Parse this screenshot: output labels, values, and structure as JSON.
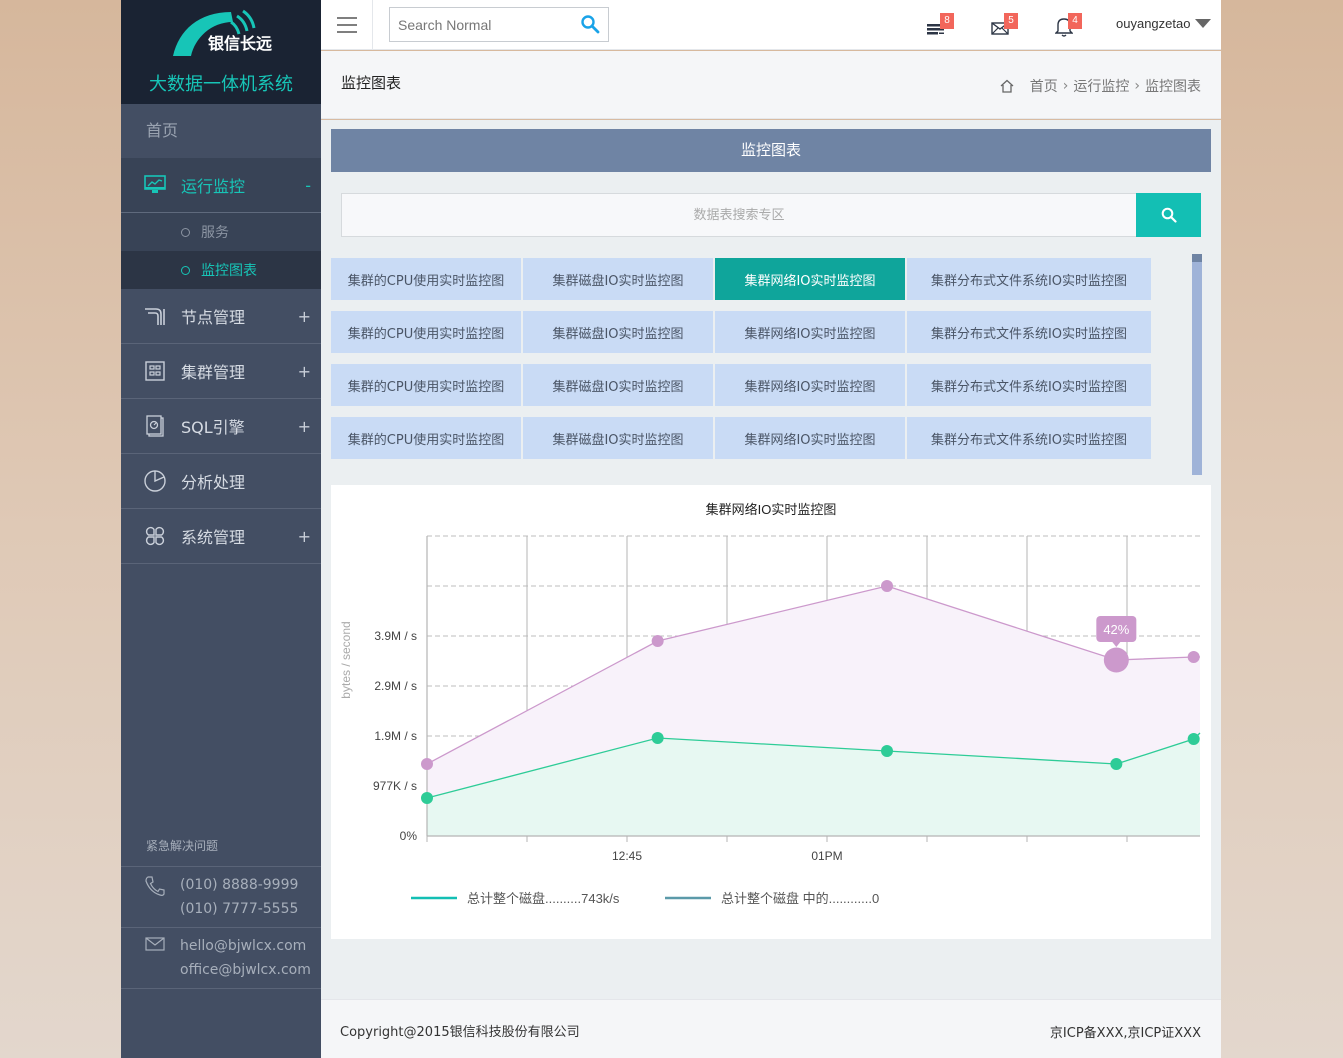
{
  "brand": {
    "logo_text": "银信长远",
    "system_name": "大数据一体机系统"
  },
  "sidebar": {
    "home_label": "首页",
    "items": [
      {
        "label": "运行监控",
        "icon": "monitor-chart-icon",
        "toggle": "-",
        "active": true,
        "children": [
          {
            "label": "服务",
            "active": false
          },
          {
            "label": "监控图表",
            "active": true
          }
        ]
      },
      {
        "label": "节点管理",
        "icon": "node-icon",
        "toggle": "+"
      },
      {
        "label": "集群管理",
        "icon": "cluster-grid-icon",
        "toggle": "+"
      },
      {
        "label": "SQL引擎",
        "icon": "sql-engine-icon",
        "toggle": "+"
      },
      {
        "label": "分析处理",
        "icon": "pie-chart-icon",
        "toggle": ""
      },
      {
        "label": "系统管理",
        "icon": "system-apps-icon",
        "toggle": "+"
      }
    ],
    "support": {
      "title": "紧急解决问题",
      "phones": [
        "(010) 8888-9999",
        "(010) 7777-5555"
      ],
      "emails": [
        "hello@bjwlcx.com",
        "office@bjwlcx.com"
      ]
    }
  },
  "topbar": {
    "search_placeholder": "Search Normal",
    "tasks_badge": "8",
    "messages_badge": "5",
    "notifications_badge": "4",
    "username": "ouyangzetao",
    "accent": "#1aa3e8"
  },
  "pagehead": {
    "title": "监控图表",
    "breadcrumb": [
      "首页",
      "运行监控",
      "监控图表"
    ]
  },
  "content": {
    "panel_title": "监控图表",
    "search_placeholder": "数据表搜索专区",
    "grid": [
      [
        "集群的CPU使用实时监控图",
        "集群磁盘IO实时监控图",
        "集群网络IO实时监控图",
        "集群分布式文件系统IO实时监控图"
      ],
      [
        "集群的CPU使用实时监控图",
        "集群磁盘IO实时监控图",
        "集群网络IO实时监控图",
        "集群分布式文件系统IO实时监控图"
      ],
      [
        "集群的CPU使用实时监控图",
        "集群磁盘IO实时监控图",
        "集群网络IO实时监控图",
        "集群分布式文件系统IO实时监控图"
      ],
      [
        "集群的CPU使用实时监控图",
        "集群磁盘IO实时监控图",
        "集群网络IO实时监控图",
        "集群分布式文件系统IO实时监控图"
      ]
    ],
    "selected_cell": [
      0,
      2
    ],
    "selected_color": "#0fa59b"
  },
  "chart_data": {
    "type": "area",
    "title": "集群网络IO实时监控图",
    "xlabel": "",
    "ylabel": "bytes / second",
    "x_unit": "minutes after 12:00",
    "xlim": [
      30,
      88
    ],
    "x_ticks": [
      {
        "value": 45,
        "label": "12:45"
      },
      {
        "value": 60,
        "label": "01PM"
      }
    ],
    "x_grid": [
      30,
      37.5,
      45,
      52.5,
      60,
      67.5,
      75,
      82.5
    ],
    "ylim": [
      0,
      5862
    ],
    "y_unit": "K/s",
    "y_ticks": [
      {
        "value": 0,
        "label": "0%"
      },
      {
        "value": 977,
        "label": "977K / s"
      },
      {
        "value": 1954,
        "label": "1.9M / s"
      },
      {
        "value": 2931,
        "label": "2.9M / s"
      },
      {
        "value": 3908,
        "label": "3.9M / s"
      },
      {
        "value": 4885,
        "label": ""
      },
      {
        "value": 5862,
        "label": ""
      }
    ],
    "grid": true,
    "legend_position": "bottom-left",
    "series": [
      {
        "name": "total",
        "color": "#cc99cc",
        "fill": "#f8f2fa",
        "x": [
          30,
          47.3,
          64.5,
          81.7,
          87.5
        ],
        "values": [
          1407,
          3810,
          4885,
          3439,
          3498
        ]
      },
      {
        "name": "disk",
        "color": "#2ecc97",
        "fill": "#e7f8f2",
        "x": [
          30,
          47.3,
          64.5,
          81.7,
          87.5
        ],
        "values": [
          743,
          1915,
          1661,
          1407,
          1895
        ]
      }
    ],
    "highlight": {
      "series": 0,
      "index": 3,
      "label": "42%"
    },
    "legend": [
      {
        "label": "总计整个磁盘..........743k/s",
        "color": "#13bfb4"
      },
      {
        "label": "总计整个磁盘 中的............0",
        "color": "#5b9aa9"
      }
    ]
  },
  "footer": {
    "copyright": "Copyright@2015银信科技股份有限公司",
    "icp": "京ICP备XXX,京ICP证XXX"
  }
}
